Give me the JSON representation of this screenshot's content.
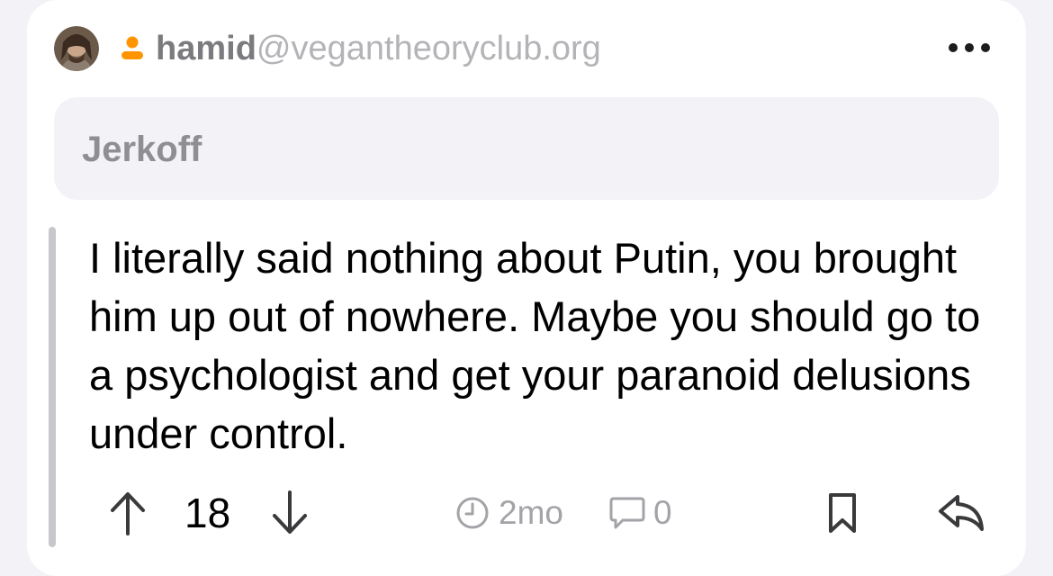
{
  "post": {
    "author": {
      "name": "hamid",
      "instance": "@vegantheoryclub.org",
      "avatar_icon": "avatar",
      "badge_icon": "user-icon",
      "badge_color": "#ff9500"
    },
    "more_icon": "more-horizontal-icon",
    "parent_preview": "Jerkoff",
    "body": "I literally said nothing about Putin, you brought him up out of nowhere. Maybe you should go to a psychologist and get your paranoid delusions under control.",
    "score": "18",
    "age": "2mo",
    "comment_count": "0",
    "icons": {
      "upvote": "arrow-up-icon",
      "downvote": "arrow-down-icon",
      "time": "clock-icon",
      "comments": "speech-bubble-icon",
      "bookmark": "bookmark-icon",
      "reply": "reply-arrow-icon"
    }
  },
  "colors": {
    "background": "#f2f2f7",
    "card": "#ffffff",
    "text": "#000000",
    "muted": "#8e8e93",
    "thread_line": "#c7c7cc"
  }
}
